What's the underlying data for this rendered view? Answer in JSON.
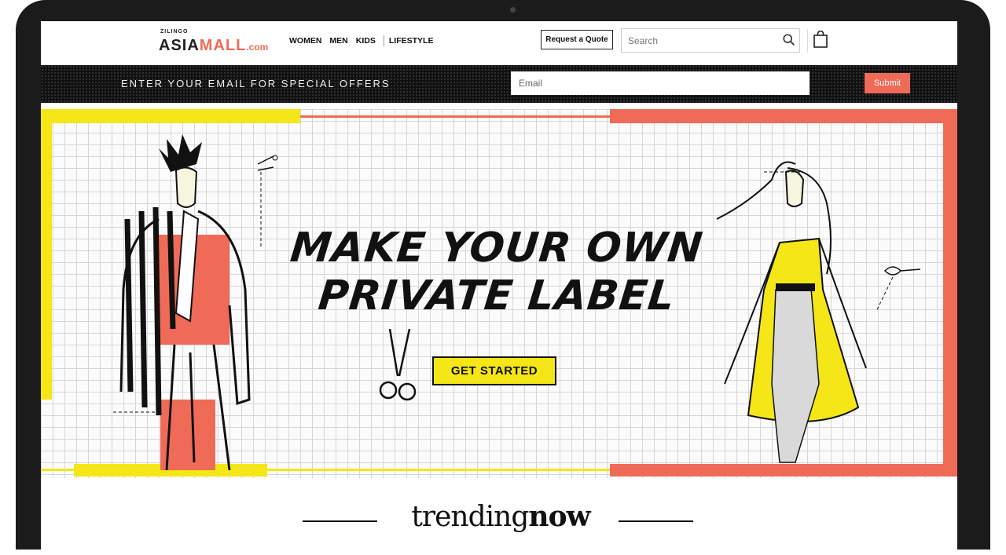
{
  "logo": {
    "small": "ZILINGO",
    "asia": "ASIA",
    "mall": "MALL",
    "dotcom": ".com"
  },
  "nav": {
    "women": "WOMEN",
    "men": "MEN",
    "kids": "KIDS",
    "lifestyle": "LIFESTYLE"
  },
  "header": {
    "quote_label": "Request a Quote",
    "search_placeholder": "Search"
  },
  "email_bar": {
    "prompt": "ENTER YOUR EMAIL FOR SPECIAL OFFERS",
    "email_placeholder": "Email",
    "submit_label": "Submit"
  },
  "hero": {
    "headline_line1": "MAKE YOUR OWN",
    "headline_line2": "PRIVATE LABEL",
    "cta_label": "GET STARTED"
  },
  "trending": {
    "light": "trending",
    "bold": "now"
  },
  "colors": {
    "accent": "#ef6b57",
    "yellow": "#f4e617",
    "dark": "#101010"
  },
  "icons": [
    "search-icon",
    "shopping-bag-icon",
    "scissors-icon",
    "measuring-tape-icon"
  ]
}
